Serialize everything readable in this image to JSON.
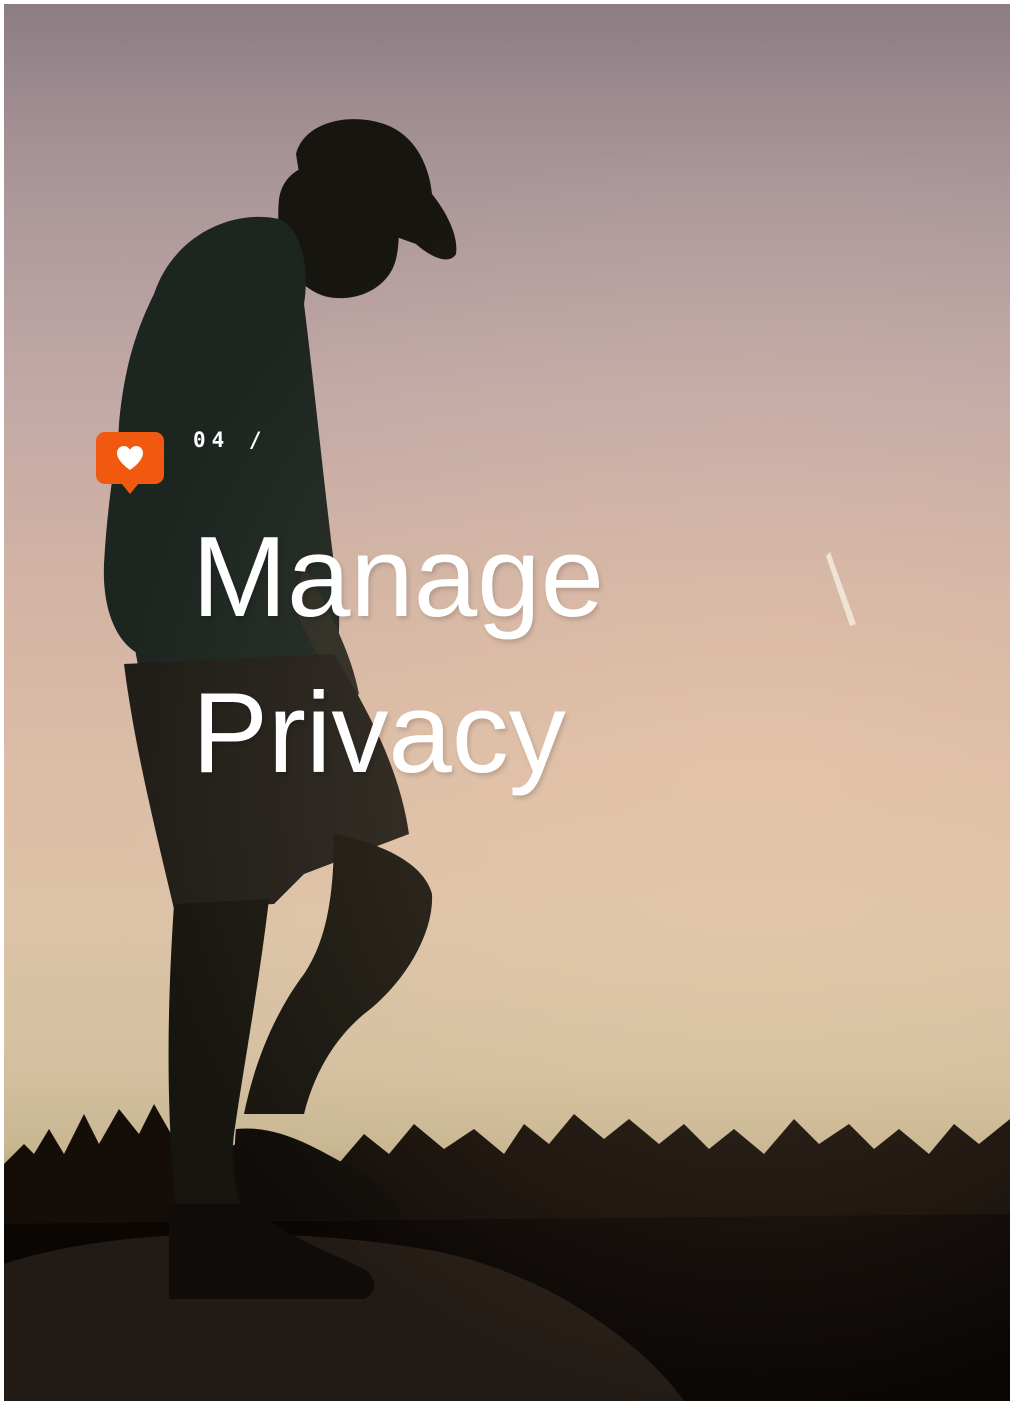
{
  "slide": {
    "section_number": "04 /",
    "title_line_1": "Manage",
    "title_line_2": "Privacy"
  },
  "badge": {
    "icon": "heart-icon",
    "color": "#f0590f"
  },
  "photo": {
    "subject": "silhouette-photo"
  }
}
